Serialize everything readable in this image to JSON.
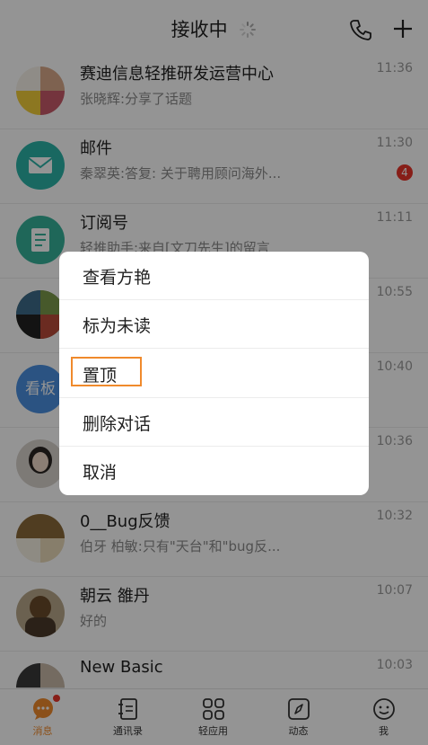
{
  "header": {
    "title": "接收中",
    "icons": [
      "loading-spinner-icon",
      "phone-icon",
      "plus-icon"
    ]
  },
  "conversations": [
    {
      "name": "赛迪信息轻推研发运营中心",
      "preview": "张晓辉:分享了话题",
      "time": "11:36",
      "badge": ""
    },
    {
      "name": "邮件",
      "preview": "秦翠英:答复: 关于聘用顾问海外...",
      "time": "11:30",
      "badge": "4"
    },
    {
      "name": "订阅号",
      "preview": "轻推助手:来自[文刀先生]的留言",
      "time": "11:11",
      "badge": ""
    },
    {
      "name": "",
      "preview": "",
      "time": "10:55",
      "badge": ""
    },
    {
      "name": "",
      "preview": "",
      "time": "10:40",
      "badge": "",
      "avatar_text": "看板"
    },
    {
      "name": "",
      "preview": "",
      "time": "10:36",
      "badge": ""
    },
    {
      "name": "0__Bug反馈",
      "preview": "伯牙 柏敏:只有\"天台\"和\"bug反...",
      "time": "10:32",
      "badge": ""
    },
    {
      "name": "朝云 雒丹",
      "preview": "好的",
      "time": "10:07",
      "badge": ""
    },
    {
      "name": "New Basic",
      "preview": "",
      "time": "10:03",
      "badge": ""
    }
  ],
  "menu": {
    "items": [
      "查看方艳",
      "标为未读",
      "置顶",
      "删除对话",
      "取消"
    ],
    "highlighted_index": 2
  },
  "tabbar": {
    "tabs": [
      "消息",
      "通讯录",
      "轻应用",
      "动态",
      "我"
    ],
    "active_index": 0
  },
  "colors": {
    "accent": "#f08a2c",
    "badge": "#e8352a",
    "mail": "#2bb3a8",
    "subscription": "#36b29a",
    "kanban": "#4a8fe0"
  }
}
